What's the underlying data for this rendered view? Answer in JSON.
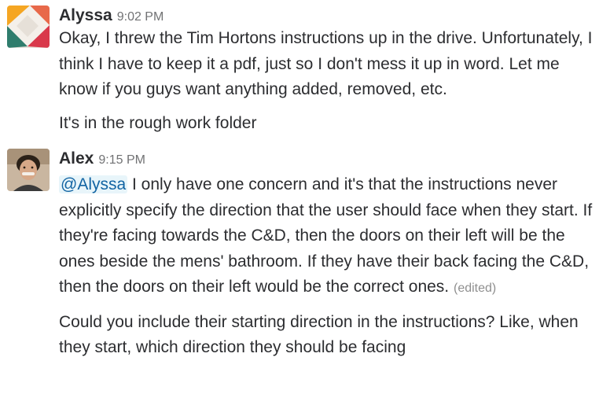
{
  "messages": [
    {
      "author": "Alyssa",
      "time": "9:02 PM",
      "avatar": "alyssa-avatar",
      "paragraphs": [
        "Okay, I threw the Tim Hortons instructions up in the drive. Unfortunately, I think I have to keep it a pdf, just so I don't mess it up in word. Let me know if you guys want anything added, removed, etc.",
        "It's in the rough work folder"
      ]
    },
    {
      "author": "Alex",
      "time": "9:15 PM",
      "avatar": "alex-avatar",
      "mention": "@Alyssa",
      "paragraph1_rest": " I only have one concern and it's that the instructions never explicitly specify the direction that the user should face when they start. If they're facing towards the C&D, then the doors on their left will be the ones beside the mens' bathroom. If they have their back facing the C&D, then the doors on their left would be the correct ones.",
      "edited_label": "(edited)",
      "paragraph2": "Could you include their starting direction in the instructions? Like, when they start, which direction they should be facing"
    }
  ],
  "colors": {
    "text": "#2c2d30",
    "timestamp": "#717274",
    "mention": "#1264a3",
    "mention_bg": "#e8f5fa"
  }
}
